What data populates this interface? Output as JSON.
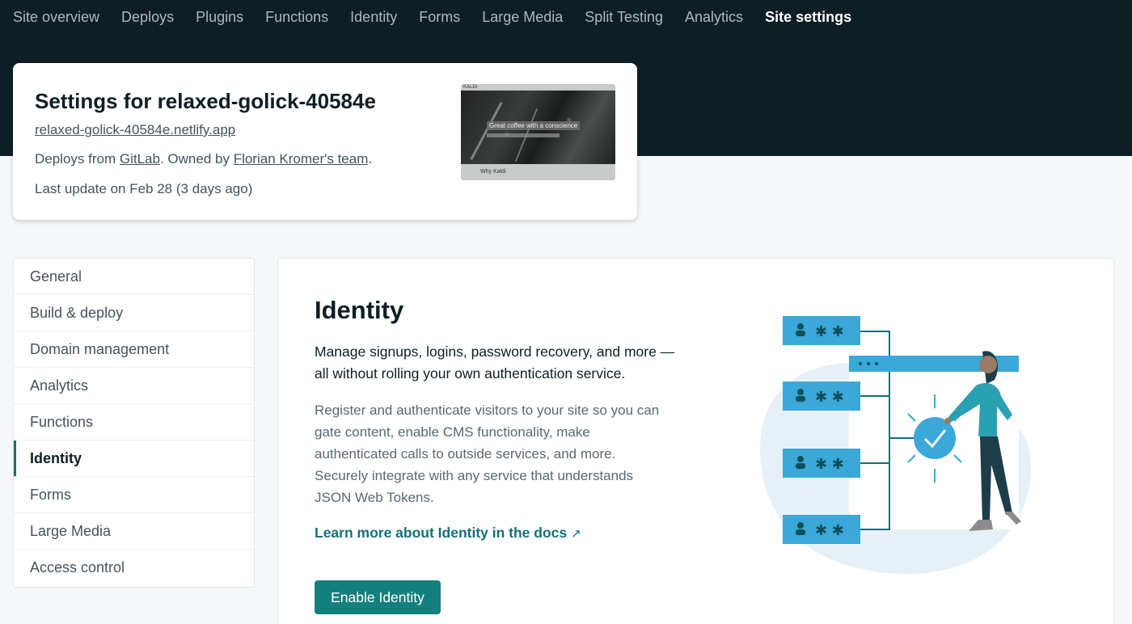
{
  "nav": {
    "items": [
      {
        "label": "Site overview",
        "active": false
      },
      {
        "label": "Deploys",
        "active": false
      },
      {
        "label": "Plugins",
        "active": false
      },
      {
        "label": "Functions",
        "active": false
      },
      {
        "label": "Identity",
        "active": false
      },
      {
        "label": "Forms",
        "active": false
      },
      {
        "label": "Large Media",
        "active": false
      },
      {
        "label": "Split Testing",
        "active": false
      },
      {
        "label": "Analytics",
        "active": false
      },
      {
        "label": "Site settings",
        "active": true
      }
    ]
  },
  "site": {
    "title": "Settings for relaxed-golick-40584e",
    "url": "relaxed-golick-40584e.netlify.app",
    "deploys_prefix": "Deploys from ",
    "deploys_provider": "GitLab",
    "deploys_middle": ". Owned by ",
    "deploys_owner": "Florian Kromer's team",
    "deploys_suffix": ".",
    "last_update": "Last update on Feb 28 (3 days ago)",
    "thumbnail": {
      "brand": "KALDI",
      "headline": "Great coffee with a conscience",
      "footer": "Why Kaldi"
    }
  },
  "sidebar": {
    "items": [
      {
        "label": "General",
        "active": false
      },
      {
        "label": "Build & deploy",
        "active": false
      },
      {
        "label": "Domain management",
        "active": false
      },
      {
        "label": "Analytics",
        "active": false
      },
      {
        "label": "Functions",
        "active": false
      },
      {
        "label": "Identity",
        "active": true
      },
      {
        "label": "Forms",
        "active": false
      },
      {
        "label": "Large Media",
        "active": false
      },
      {
        "label": "Access control",
        "active": false
      }
    ]
  },
  "main": {
    "title": "Identity",
    "lead": "Manage signups, logins, password recovery, and more — all without rolling your own authentication service.",
    "description": "Register and authenticate visitors to your site so you can gate content, enable CMS functionality, make authenticated calls to outside services, and more. Securely integrate with any service that understands JSON Web Tokens.",
    "link_label": "Learn more about Identity in the docs",
    "link_icon": "external-arrow-icon",
    "button_label": "Enable Identity"
  },
  "colors": {
    "header_bg": "#0e1e25",
    "accent": "#14707a",
    "button": "#14807e",
    "illustration_blue": "#3aa8d8"
  }
}
